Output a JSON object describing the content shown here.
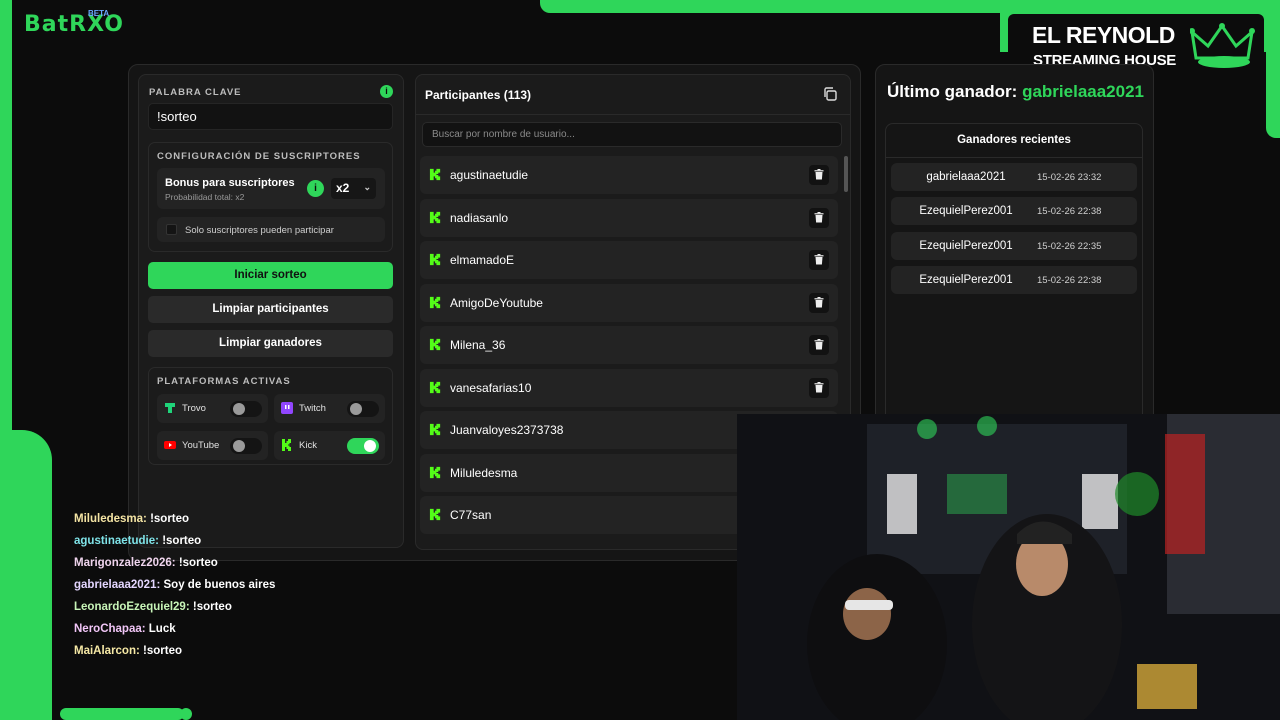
{
  "app": {
    "logo": "BatRXO",
    "beta": "BETA"
  },
  "brand": {
    "line1": "EL REYNOLD",
    "line2": "STREAMING HOUSE"
  },
  "keyword": {
    "label": "PALABRA CLAVE",
    "value": "!sorteo"
  },
  "subs": {
    "label": "CONFIGURACIÓN DE SUSCRIPTORES",
    "bonus_title": "Bonus para suscriptores",
    "bonus_sub": "Probabilidad total: x2",
    "multiplier": "x2",
    "only_subs": "Solo suscriptores pueden participar"
  },
  "buttons": {
    "start": "Iniciar sorteo",
    "clear_participants": "Limpiar participantes",
    "clear_winners": "Limpiar ganadores"
  },
  "platforms": {
    "label": "PLATAFORMAS ACTIVAS",
    "items": [
      {
        "name": "Trovo",
        "enabled": false,
        "color": "#1fd47a"
      },
      {
        "name": "Twitch",
        "enabled": false,
        "color": "#9146ff"
      },
      {
        "name": "YouTube",
        "enabled": false,
        "color": "#ff0000"
      },
      {
        "name": "Kick",
        "enabled": true,
        "color": "#53fc18"
      }
    ]
  },
  "participants": {
    "title": "Participantes (113)",
    "search_placeholder": "Buscar por nombre de usuario...",
    "items": [
      "agustinaetudie",
      "nadiasanlo",
      "elmamadoE",
      "AmigoDeYoutube",
      "Milena_36",
      "vanesafarias10",
      "Juanvaloyes2373738",
      "Miluledesma",
      "C77san"
    ]
  },
  "last_winner": {
    "label": "Último ganador:",
    "name": "gabrielaaa2021"
  },
  "recent_winners": {
    "title": "Ganadores recientes",
    "items": [
      {
        "name": "gabrielaaa2021",
        "date": "15-02-26 23:32"
      },
      {
        "name": "EzequielPerez001",
        "date": "15-02-26 22:38"
      },
      {
        "name": "EzequielPerez001",
        "date": "15-02-26 22:35"
      },
      {
        "name": "EzequielPerez001",
        "date": "15-02-26 22:38"
      }
    ]
  },
  "chat": [
    {
      "user": "Miluledesma:",
      "msg": "!sorteo",
      "color": "#f4e4a4"
    },
    {
      "user": "agustinaetudie:",
      "msg": "!sorteo",
      "color": "#7fe3e8"
    },
    {
      "user": "Marigonzalez2026:",
      "msg": "!sorteo",
      "color": "#f0d5ee"
    },
    {
      "user": "gabrielaaa2021:",
      "msg": "Soy de buenos aires",
      "color": "#e4d6ff"
    },
    {
      "user": "LeonardoEzequiel29:",
      "msg": "!sorteo",
      "color": "#c8f5b8"
    },
    {
      "user": "NeroChapaa:",
      "msg": "Luck",
      "color": "#f1c6f7"
    },
    {
      "user": "MaiAlarcon:",
      "msg": "!sorteo",
      "color": "#f6e9a6"
    }
  ],
  "colors": {
    "accent": "#2fd65a",
    "background": "#0c0c0c",
    "panel": "#1b1b1b"
  }
}
